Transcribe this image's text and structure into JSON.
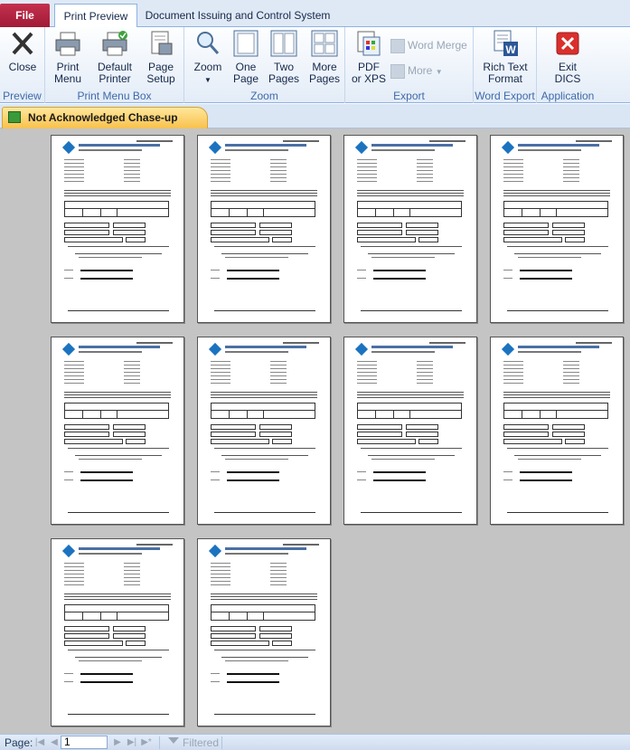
{
  "tabs": {
    "file": "File",
    "print_preview": "Print Preview",
    "dics": "Document Issuing and Control System"
  },
  "ribbon": {
    "preview": {
      "label": "Preview",
      "close": "Close"
    },
    "print_menu_box": {
      "label": "Print Menu Box",
      "print_menu": "Print\nMenu",
      "default_printer": "Default\nPrinter",
      "page_setup": "Page\nSetup"
    },
    "zoom": {
      "label": "Zoom",
      "zoom": "Zoom",
      "one_page": "One\nPage",
      "two_pages": "Two\nPages",
      "more_pages": "More\nPages"
    },
    "export": {
      "label": "Export",
      "pdf_xps": "PDF\nor XPS",
      "word_merge": "Word Merge",
      "more": "More"
    },
    "word_export": {
      "label": "Word Export",
      "rich_text": "Rich Text\nFormat"
    },
    "application": {
      "label": "Application",
      "exit": "Exit\nDICS"
    }
  },
  "document_tab": "Not Acknowledged Chase-up Letters",
  "preview": {
    "page_count": 10
  },
  "statusbar": {
    "page_label": "Page:",
    "page_value": "1",
    "filtered": "Filtered"
  },
  "colors": {
    "file_tab": "#b3213f",
    "ribbon_label": "#3e6aaa",
    "doc_tab": "#f8c14d",
    "preview_bg": "#c4c4c4"
  }
}
